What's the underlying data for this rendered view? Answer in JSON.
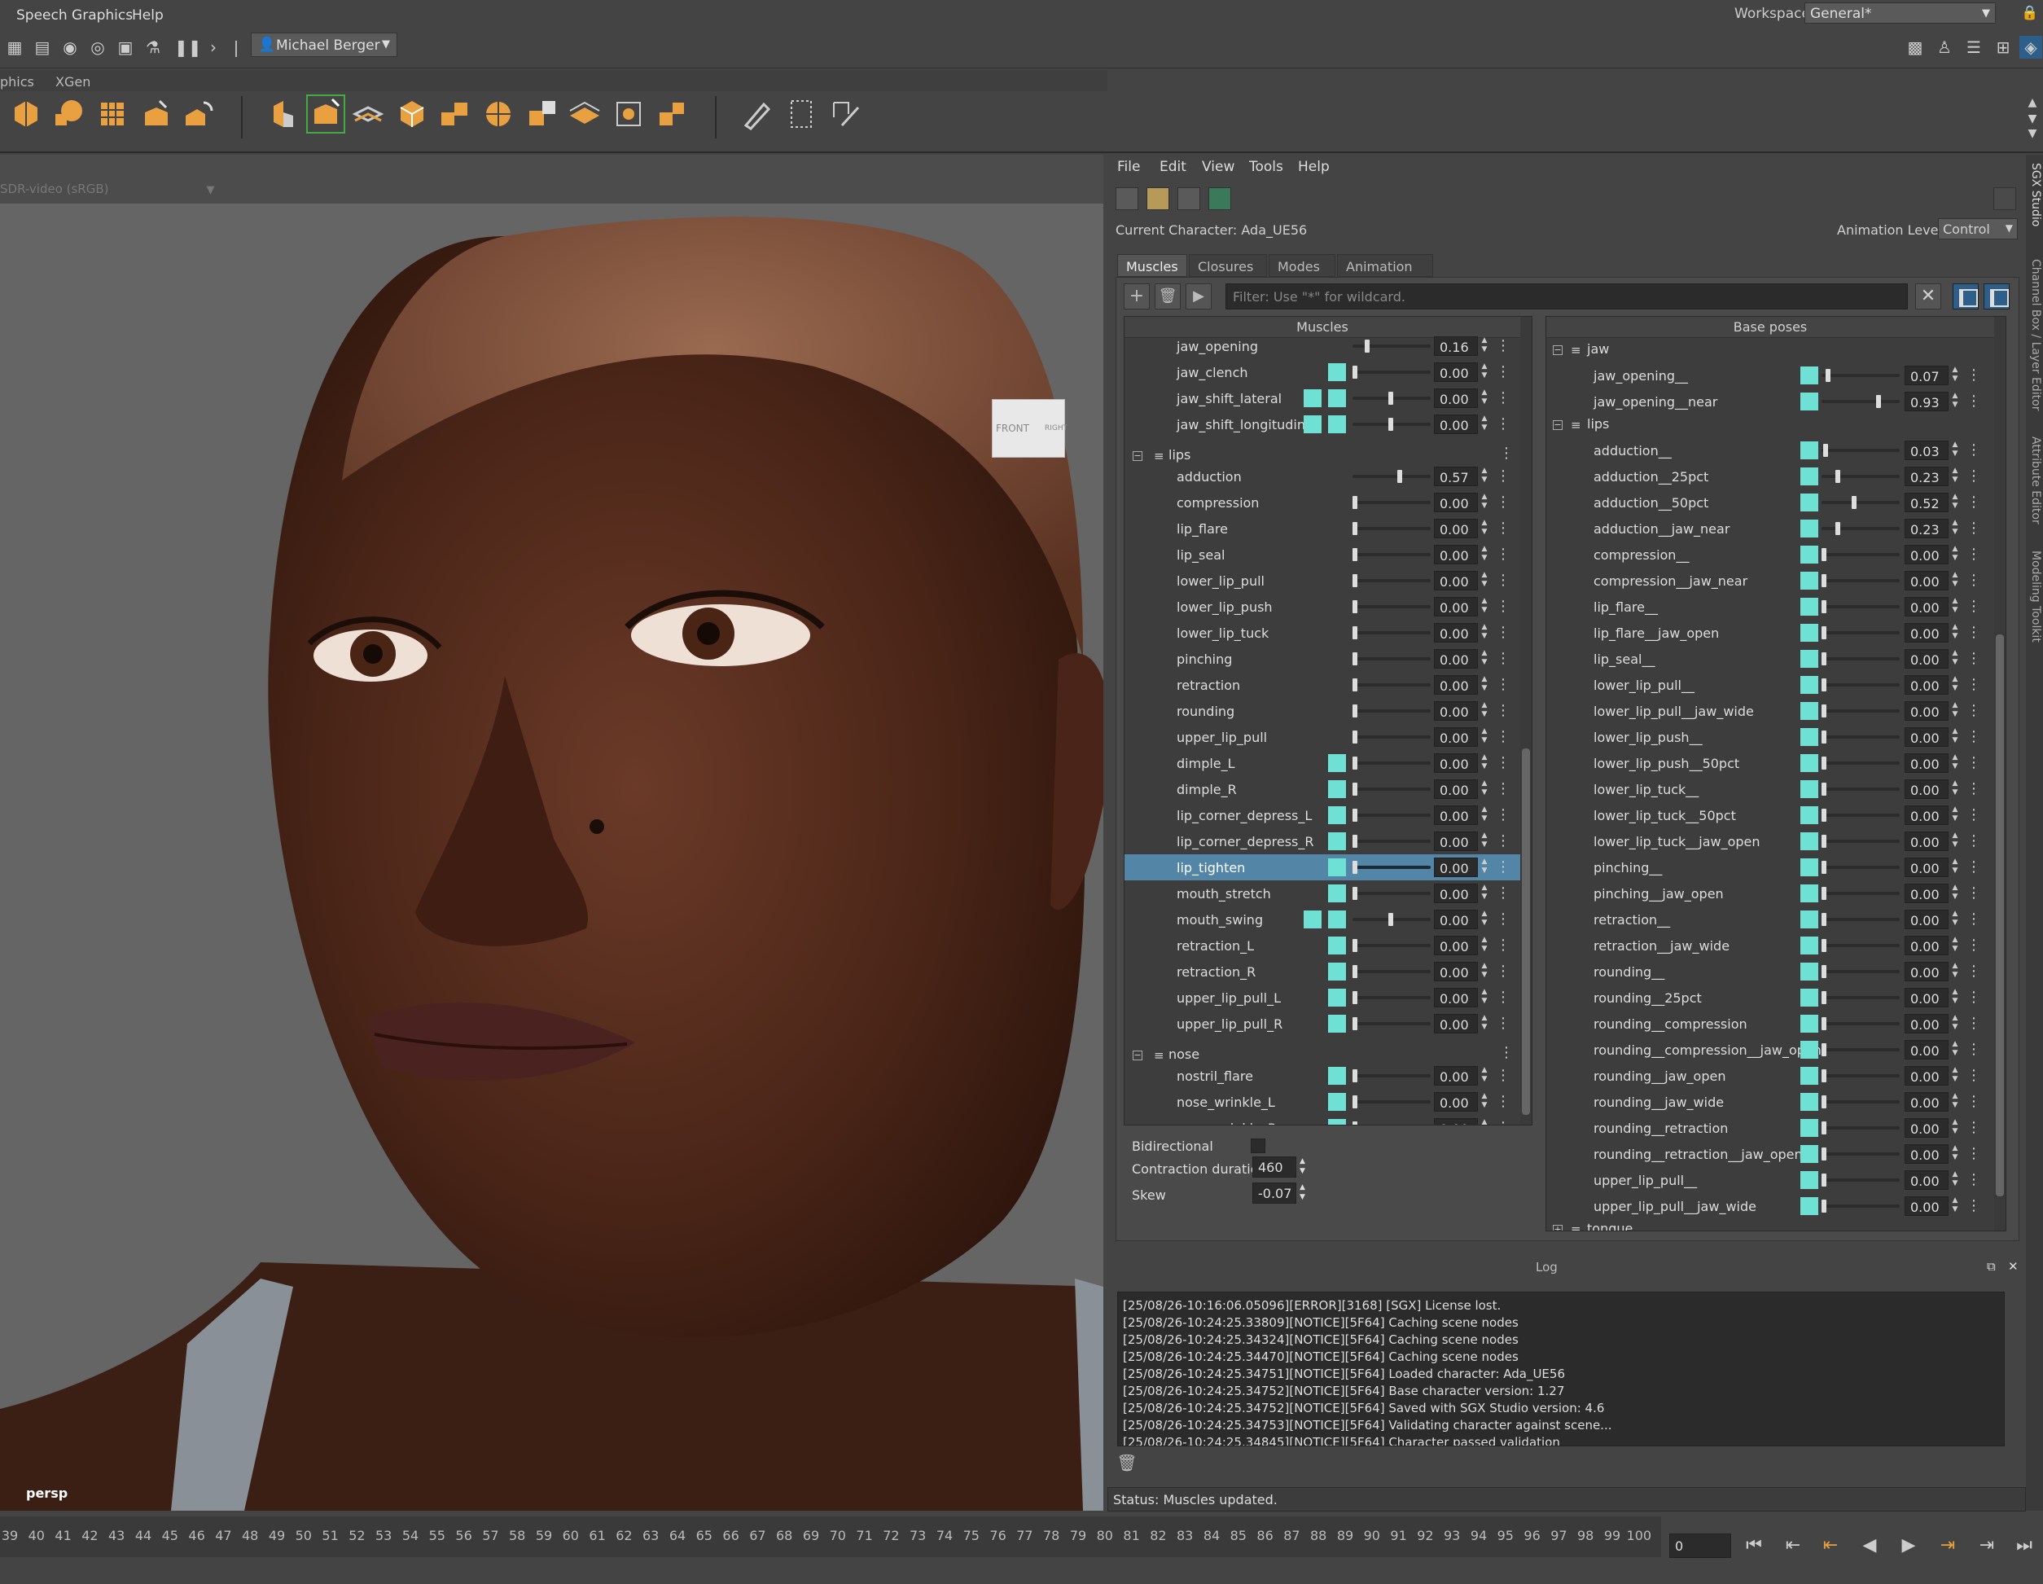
{
  "menubar": {
    "items": [
      "Speech Graphics",
      "Help"
    ],
    "workspace_label": "Workspace:",
    "workspace_value": "General*"
  },
  "statusline": {
    "user": "Michael Berger"
  },
  "shelf": {
    "tabs": [
      "phics",
      "XGen"
    ]
  },
  "viewport": {
    "colorspace": "SDR-video (sRGB)",
    "camera": "persp",
    "viewcube_front": "FRONT",
    "viewcube_right": "RIGHT"
  },
  "panel": {
    "menu": [
      "File",
      "Edit",
      "View",
      "Tools",
      "Help"
    ],
    "current_character": "Current Character: Ada_UE56",
    "animation_level_label": "Animation Level:",
    "animation_level": "Control",
    "tabs": [
      "Muscles",
      "Closures",
      "Modes",
      "Animation"
    ],
    "filter_placeholder": "Filter: Use \"*\" for wildcard.",
    "muscles_header": "Muscles",
    "base_poses_header": "Base poses",
    "bidirectional_label": "Bidirectional",
    "contraction_label": "Contraction duration",
    "contraction_value": "460",
    "skew_label": "Skew",
    "skew_value": "-0.07"
  },
  "muscles": [
    {
      "name": "jaw_opening",
      "value": "0.16",
      "level": 0.16,
      "tl": 0
    },
    {
      "name": "jaw_clench",
      "value": "0.00",
      "level": 0,
      "tl": 1
    },
    {
      "name": "jaw_shift_lateral",
      "value": "0.00",
      "level": 0.5,
      "tl": 2
    },
    {
      "name": "jaw_shift_longitudinal",
      "value": "0.00",
      "level": 0.5,
      "tl": 2
    },
    {
      "group": "lips"
    },
    {
      "name": "adduction",
      "value": "0.57",
      "level": 0.57,
      "tl": 0
    },
    {
      "name": "compression",
      "value": "0.00",
      "level": 0,
      "tl": 0
    },
    {
      "name": "lip_flare",
      "value": "0.00",
      "level": 0,
      "tl": 0
    },
    {
      "name": "lip_seal",
      "value": "0.00",
      "level": 0,
      "tl": 0
    },
    {
      "name": "lower_lip_pull",
      "value": "0.00",
      "level": 0,
      "tl": 0
    },
    {
      "name": "lower_lip_push",
      "value": "0.00",
      "level": 0,
      "tl": 0
    },
    {
      "name": "lower_lip_tuck",
      "value": "0.00",
      "level": 0,
      "tl": 0
    },
    {
      "name": "pinching",
      "value": "0.00",
      "level": 0,
      "tl": 0
    },
    {
      "name": "retraction",
      "value": "0.00",
      "level": 0,
      "tl": 0
    },
    {
      "name": "rounding",
      "value": "0.00",
      "level": 0,
      "tl": 0
    },
    {
      "name": "upper_lip_pull",
      "value": "0.00",
      "level": 0,
      "tl": 0
    },
    {
      "name": "dimple_L",
      "value": "0.00",
      "level": 0,
      "tl": 1
    },
    {
      "name": "dimple_R",
      "value": "0.00",
      "level": 0,
      "tl": 1
    },
    {
      "name": "lip_corner_depress_L",
      "value": "0.00",
      "level": 0,
      "tl": 1
    },
    {
      "name": "lip_corner_depress_R",
      "value": "0.00",
      "level": 0,
      "tl": 1
    },
    {
      "name": "lip_tighten",
      "value": "0.00",
      "level": 0,
      "tl": 1,
      "selected": true
    },
    {
      "name": "mouth_stretch",
      "value": "0.00",
      "level": 0,
      "tl": 1
    },
    {
      "name": "mouth_swing",
      "value": "0.00",
      "level": 0.5,
      "tl": 2
    },
    {
      "name": "retraction_L",
      "value": "0.00",
      "level": 0,
      "tl": 1
    },
    {
      "name": "retraction_R",
      "value": "0.00",
      "level": 0,
      "tl": 1
    },
    {
      "name": "upper_lip_pull_L",
      "value": "0.00",
      "level": 0,
      "tl": 1
    },
    {
      "name": "upper_lip_pull_R",
      "value": "0.00",
      "level": 0,
      "tl": 1
    },
    {
      "group": "nose"
    },
    {
      "name": "nostril_flare",
      "value": "0.00",
      "level": 0,
      "tl": 1
    },
    {
      "name": "nose_wrinkle_L",
      "value": "0.00",
      "level": 0,
      "tl": 1
    },
    {
      "name": "nose_wrinkle_R",
      "value": "0.00",
      "level": 0,
      "tl": 1
    }
  ],
  "base_poses": [
    {
      "group": "jaw"
    },
    {
      "name": "jaw_opening__",
      "value": "0.07",
      "level": 0.07
    },
    {
      "name": "jaw_opening__near",
      "value": "0.93",
      "level": 0.93
    },
    {
      "group": "lips"
    },
    {
      "name": "adduction__",
      "value": "0.03",
      "level": 0.03
    },
    {
      "name": "adduction__25pct",
      "value": "0.23",
      "level": 0.23
    },
    {
      "name": "adduction__50pct",
      "value": "0.52",
      "level": 0.52
    },
    {
      "name": "adduction__jaw_near",
      "value": "0.23",
      "level": 0.23
    },
    {
      "name": "compression__",
      "value": "0.00",
      "level": 0
    },
    {
      "name": "compression__jaw_near",
      "value": "0.00",
      "level": 0
    },
    {
      "name": "lip_flare__",
      "value": "0.00",
      "level": 0
    },
    {
      "name": "lip_flare__jaw_open",
      "value": "0.00",
      "level": 0
    },
    {
      "name": "lip_seal__",
      "value": "0.00",
      "level": 0
    },
    {
      "name": "lower_lip_pull__",
      "value": "0.00",
      "level": 0
    },
    {
      "name": "lower_lip_pull__jaw_wide",
      "value": "0.00",
      "level": 0
    },
    {
      "name": "lower_lip_push__",
      "value": "0.00",
      "level": 0
    },
    {
      "name": "lower_lip_push__50pct",
      "value": "0.00",
      "level": 0
    },
    {
      "name": "lower_lip_tuck__",
      "value": "0.00",
      "level": 0
    },
    {
      "name": "lower_lip_tuck__50pct",
      "value": "0.00",
      "level": 0
    },
    {
      "name": "lower_lip_tuck__jaw_open",
      "value": "0.00",
      "level": 0
    },
    {
      "name": "pinching__",
      "value": "0.00",
      "level": 0
    },
    {
      "name": "pinching__jaw_open",
      "value": "0.00",
      "level": 0
    },
    {
      "name": "retraction__",
      "value": "0.00",
      "level": 0
    },
    {
      "name": "retraction__jaw_wide",
      "value": "0.00",
      "level": 0
    },
    {
      "name": "rounding__",
      "value": "0.00",
      "level": 0
    },
    {
      "name": "rounding__25pct",
      "value": "0.00",
      "level": 0
    },
    {
      "name": "rounding__compression",
      "value": "0.00",
      "level": 0
    },
    {
      "name": "rounding__compression__jaw_open",
      "value": "0.00",
      "level": 0
    },
    {
      "name": "rounding__jaw_open",
      "value": "0.00",
      "level": 0
    },
    {
      "name": "rounding__jaw_wide",
      "value": "0.00",
      "level": 0
    },
    {
      "name": "rounding__retraction",
      "value": "0.00",
      "level": 0
    },
    {
      "name": "rounding__retraction__jaw_open",
      "value": "0.00",
      "level": 0
    },
    {
      "name": "upper_lip_pull__",
      "value": "0.00",
      "level": 0
    },
    {
      "name": "upper_lip_pull__jaw_wide",
      "value": "0.00",
      "level": 0
    },
    {
      "group": "tongue",
      "collapsed": true
    }
  ],
  "log": {
    "title": "Log",
    "lines": [
      "[25/08/26-10:16:06.05096][ERROR][3168] [SGX] License lost.",
      "[25/08/26-10:24:25.33809][NOTICE][5F64] Caching scene nodes",
      "[25/08/26-10:24:25.34324][NOTICE][5F64] Caching scene nodes",
      "[25/08/26-10:24:25.34470][NOTICE][5F64] Caching scene nodes",
      "[25/08/26-10:24:25.34751][NOTICE][5F64] Loaded character: Ada_UE56",
      "[25/08/26-10:24:25.34752][NOTICE][5F64] Base character version: 1.27",
      "[25/08/26-10:24:25.34752][NOTICE][5F64] Saved with SGX Studio version: 4.6",
      "[25/08/26-10:24:25.34753][NOTICE][5F64] Validating character against scene...",
      "[25/08/26-10:24:25.34845][NOTICE][5F64] Character passed validation"
    ]
  },
  "status": "Status: Muscles updated.",
  "side_tabs": [
    "SGX Studio",
    "Channel Box / Layer Editor",
    "Attribute Editor",
    "Modeling Toolkit"
  ],
  "timeline": {
    "ticks": [
      "39",
      "40",
      "41",
      "42",
      "43",
      "44",
      "45",
      "46",
      "47",
      "48",
      "49",
      "50",
      "51",
      "52",
      "53",
      "54",
      "55",
      "56",
      "57",
      "58",
      "59",
      "60",
      "61",
      "62",
      "63",
      "64",
      "65",
      "66",
      "67",
      "68",
      "69",
      "70",
      "71",
      "72",
      "73",
      "74",
      "75",
      "76",
      "77",
      "78",
      "79",
      "80",
      "81",
      "82",
      "83",
      "84",
      "85",
      "86",
      "87",
      "88",
      "89",
      "90",
      "91",
      "92",
      "93",
      "94",
      "95",
      "96",
      "97",
      "98",
      "99",
      "100"
    ],
    "current_frame": "0"
  },
  "colors": {
    "accent": "#6fe0d4",
    "selection": "#5285a6",
    "shelf_orange": "#e8a040"
  }
}
